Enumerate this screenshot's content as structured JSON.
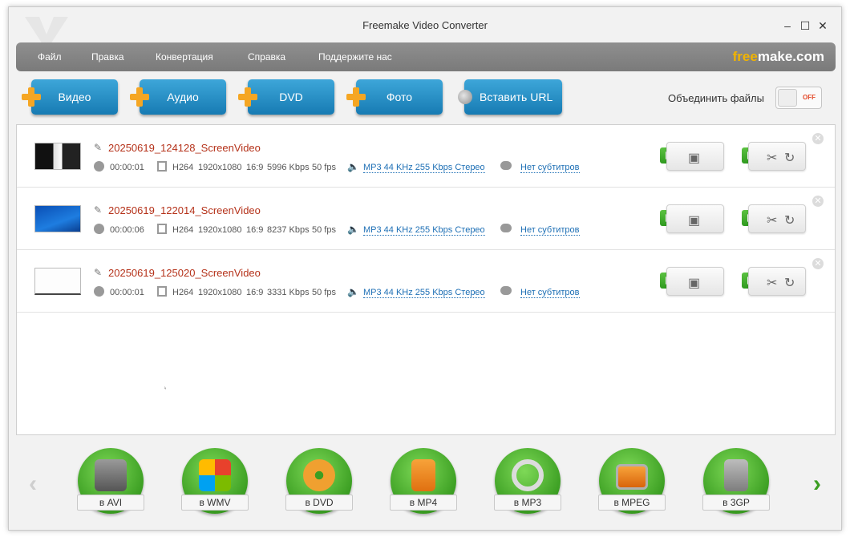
{
  "window": {
    "title": "Freemake Video Converter",
    "minimize": "–",
    "maximize": "☐",
    "close": "✕"
  },
  "menu": {
    "items": [
      "Файл",
      "Правка",
      "Конвертация",
      "Справка",
      "Поддержите нас"
    ],
    "brand_free": "free",
    "brand_rest": "make.com"
  },
  "toolbar": {
    "video": "Видео",
    "audio": "Аудио",
    "dvd": "DVD",
    "photo": "Фото",
    "url": "Вставить URL",
    "merge_label": "Объединить файлы",
    "merge_state": "OFF"
  },
  "files": [
    {
      "name": "20250619_124128_ScreenVideo",
      "duration": "00:00:01",
      "codec": "H264",
      "resolution": "1920x1080",
      "aspect": "16:9",
      "bitrate": "5996 Kbps",
      "fps": "50 fps",
      "audio": "MP3  44 KHz  255 Kbps  Стерео",
      "subtitles": "Нет субтитров"
    },
    {
      "name": "20250619_122014_ScreenVideo",
      "duration": "00:00:06",
      "codec": "H264",
      "resolution": "1920x1080",
      "aspect": "16:9",
      "bitrate": "8237 Kbps",
      "fps": "50 fps",
      "audio": "MP3  44 KHz  255 Kbps  Стерео",
      "subtitles": "Нет субтитров"
    },
    {
      "name": "20250619_125020_ScreenVideo",
      "duration": "00:00:01",
      "codec": "H264",
      "resolution": "1920x1080",
      "aspect": "16:9",
      "bitrate": "3331 Kbps",
      "fps": "50 fps",
      "audio": "MP3  44 KHz  255 Kbps  Стерео",
      "subtitles": "Нет субтитров"
    }
  ],
  "formats": [
    "в AVI",
    "в WMV",
    "в DVD",
    "в MP4",
    "в MP3",
    "в MPEG",
    "в 3GP"
  ],
  "colors": {
    "accent_blue": "#177bb3",
    "plus_orange": "#f5a623",
    "format_green": "#3b9e22",
    "filename_red": "#b5321a",
    "link_blue": "#1d6fb5"
  }
}
